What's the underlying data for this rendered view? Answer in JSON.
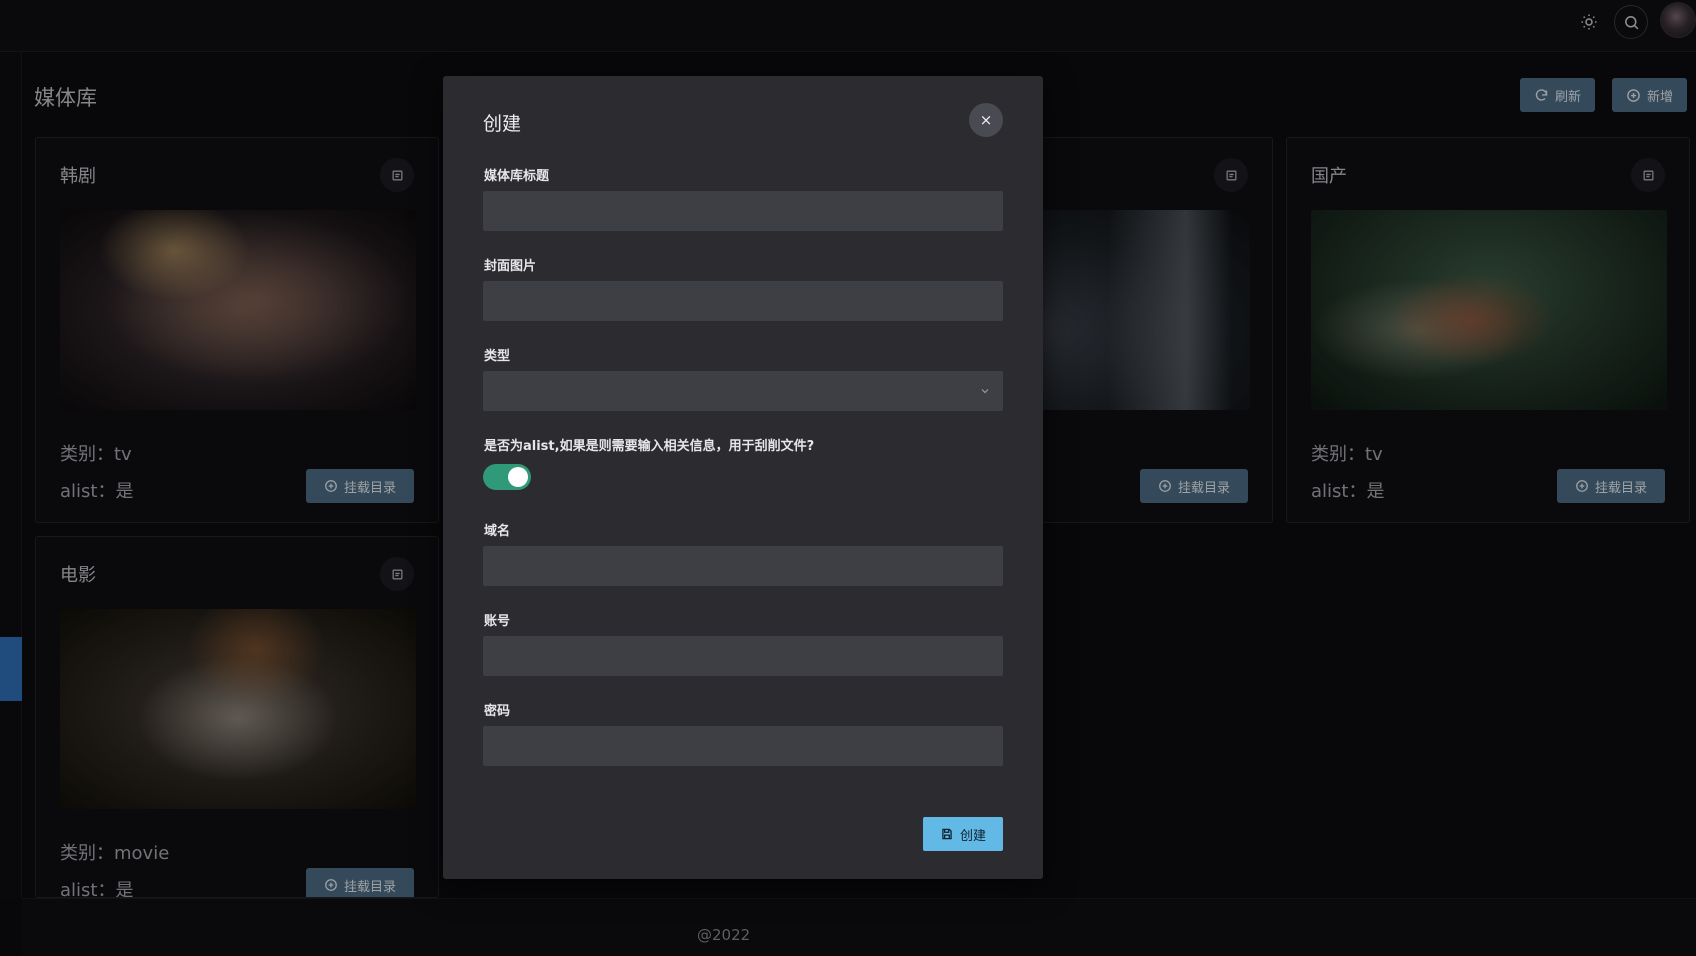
{
  "header": {
    "theme_icon": "sun-icon",
    "search_icon": "search-icon",
    "avatar_icon": "user-avatar"
  },
  "page": {
    "title": "媒体库",
    "refresh_label": "刷新",
    "add_label": "新增"
  },
  "cards": [
    {
      "title": "韩剧",
      "category_label": "类别：tv",
      "alist_label": "alist：是",
      "mount_label": "挂载目录"
    },
    {
      "title": "",
      "category_label": "",
      "alist_label": "",
      "mount_label": "挂载目录"
    },
    {
      "title": "国产",
      "category_label": "类别：tv",
      "alist_label": "alist：是",
      "mount_label": "挂载目录"
    },
    {
      "title": "电影",
      "category_label": "类别：movie",
      "alist_label": "alist：是",
      "mount_label": "挂载目录"
    }
  ],
  "modal": {
    "title": "创建",
    "close_symbol": "×",
    "fields": {
      "title_label": "媒体库标题",
      "title_value": "",
      "cover_label": "封面图片",
      "cover_value": "",
      "type_label": "类型",
      "type_value": "",
      "alist_question": "是否为alist,如果是则需要输入相关信息，用于刮削文件?",
      "alist_enabled": true,
      "domain_label": "域名",
      "domain_value": "",
      "account_label": "账号",
      "account_value": "",
      "password_label": "密码",
      "password_value": ""
    },
    "submit_label": "创建"
  },
  "footer": {
    "text": "@2022"
  },
  "colors": {
    "accent_button": "#4d6e87",
    "submit_button": "#63b9e6",
    "toggle_on": "#2f9978",
    "sidebar_active": "#2f6fb8"
  }
}
